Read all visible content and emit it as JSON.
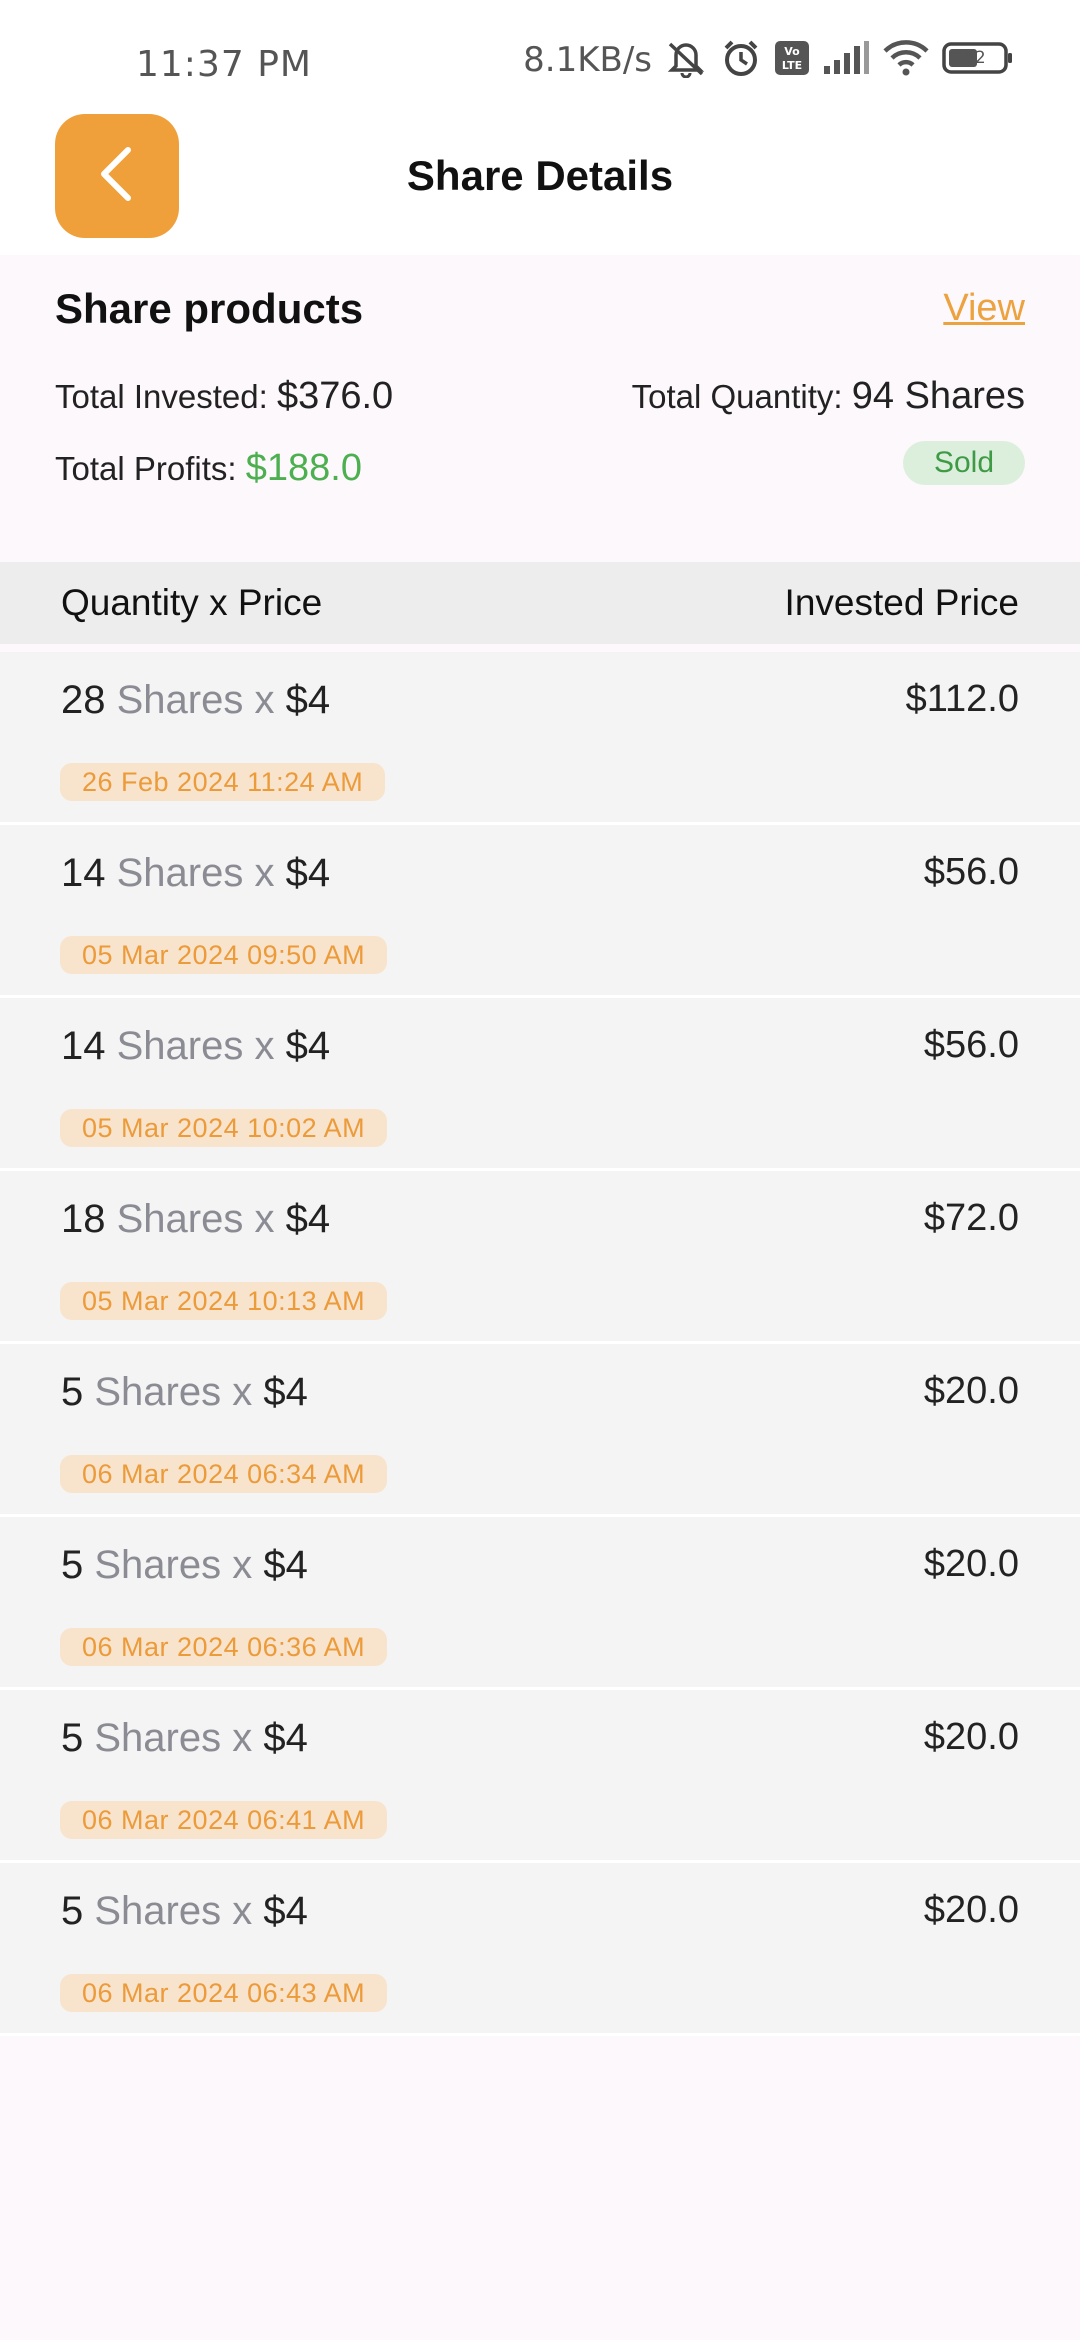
{
  "status_bar": {
    "time": "11:37 PM",
    "net_speed": "8.1KB/s",
    "battery": "52"
  },
  "header": {
    "title": "Share Details"
  },
  "summary": {
    "title": "Share products",
    "view_link": "View",
    "total_invested_label": "Total Invested:",
    "total_invested_value": "$376.0",
    "total_quantity_label": "Total Quantity:",
    "total_quantity_value": "94 Shares",
    "total_profits_label": "Total Profits:",
    "total_profits_value": "$188.0",
    "status_badge": "Sold"
  },
  "table": {
    "col_left": "Quantity x Price",
    "col_right": "Invested Price",
    "rows": [
      {
        "qty": "28",
        "shares_word": "Shares x",
        "price": "$4",
        "date": "26 Feb 2024 11:24 AM",
        "amount": "$112.0"
      },
      {
        "qty": "14",
        "shares_word": "Shares x",
        "price": "$4",
        "date": "05 Mar 2024 09:50 AM",
        "amount": "$56.0"
      },
      {
        "qty": "14",
        "shares_word": "Shares x",
        "price": "$4",
        "date": "05 Mar 2024 10:02 AM",
        "amount": "$56.0"
      },
      {
        "qty": "18",
        "shares_word": "Shares x",
        "price": "$4",
        "date": "05 Mar 2024 10:13 AM",
        "amount": "$72.0"
      },
      {
        "qty": "5",
        "shares_word": "Shares x",
        "price": "$4",
        "date": "06 Mar 2024 06:34 AM",
        "amount": "$20.0"
      },
      {
        "qty": "5",
        "shares_word": "Shares x",
        "price": "$4",
        "date": "06 Mar 2024 06:36 AM",
        "amount": "$20.0"
      },
      {
        "qty": "5",
        "shares_word": "Shares x",
        "price": "$4",
        "date": "06 Mar 2024 06:41 AM",
        "amount": "$20.0"
      },
      {
        "qty": "5",
        "shares_word": "Shares x",
        "price": "$4",
        "date": "06 Mar 2024 06:43 AM",
        "amount": "$20.0"
      }
    ]
  },
  "colors": {
    "accent": "#f0a03a",
    "profit_green": "#4caf50",
    "badge_bg": "#f8e3cc"
  }
}
